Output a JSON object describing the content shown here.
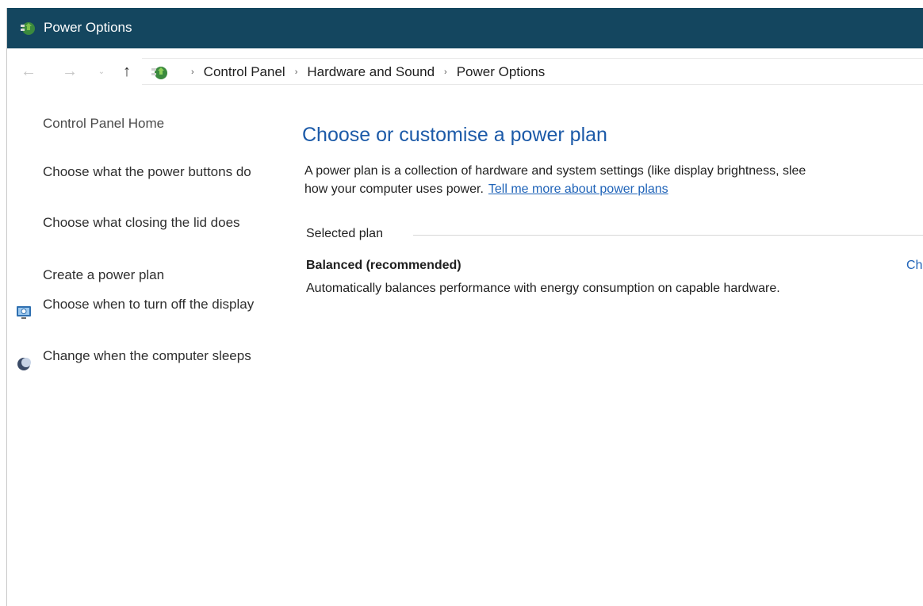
{
  "window": {
    "title": "Power Options",
    "icons": {
      "title": "power-options-icon"
    },
    "colors": {
      "titlebar": "#14465f",
      "link": "#1f63b8",
      "heading": "#1c5aa8"
    }
  },
  "nav": {
    "back": "←",
    "forward": "→",
    "recent": "⌄",
    "up": "↑"
  },
  "breadcrumb": {
    "items": [
      "Control Panel",
      "Hardware and Sound",
      "Power Options"
    ],
    "separator": "›"
  },
  "sidebar": {
    "home": "Control Panel Home",
    "links": [
      {
        "label": "Choose what the power buttons do",
        "icon": null
      },
      {
        "label": "Choose what closing the lid does",
        "icon": null
      },
      {
        "label": "Create a power plan",
        "icon": null
      },
      {
        "label": "Choose when to turn off the display",
        "icon": "display-icon"
      },
      {
        "label": "Change when the computer sleeps",
        "icon": "sleep-moon-icon"
      }
    ]
  },
  "main": {
    "heading": "Choose or customise a power plan",
    "description_line1": "A power plan is a collection of hardware and system settings (like display brightness, slee",
    "description_line2": "how your computer uses power.",
    "description_link": "Tell me more about power plans",
    "section_label": "Selected plan",
    "plan": {
      "name": "Balanced (recommended)",
      "change_link": "Cha",
      "description": "Automatically balances performance with energy consumption on capable hardware."
    }
  }
}
